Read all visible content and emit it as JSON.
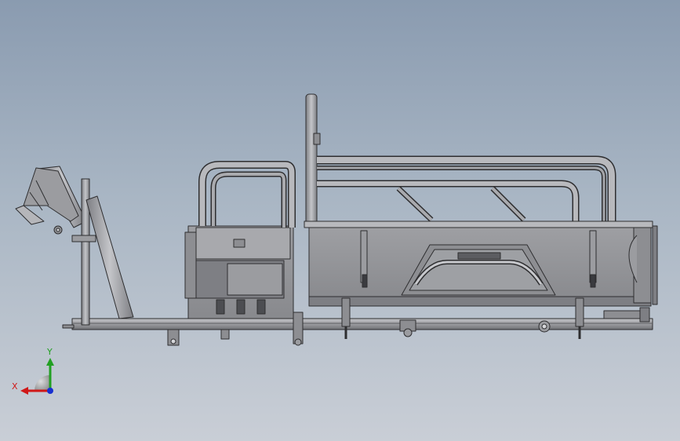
{
  "viewport": {
    "background_top": "#8a9bb0",
    "background_bottom": "#c9ced6"
  },
  "model": {
    "line_color": "#2e2e30",
    "fill_light": "#a3a4a8",
    "fill_mid": "#8d8e92",
    "fill_dark": "#6f7075"
  },
  "triad": {
    "x_label": "X",
    "y_label": "Y",
    "x_color": "#d01818",
    "y_color": "#22a022",
    "z_color": "#1830d0"
  }
}
